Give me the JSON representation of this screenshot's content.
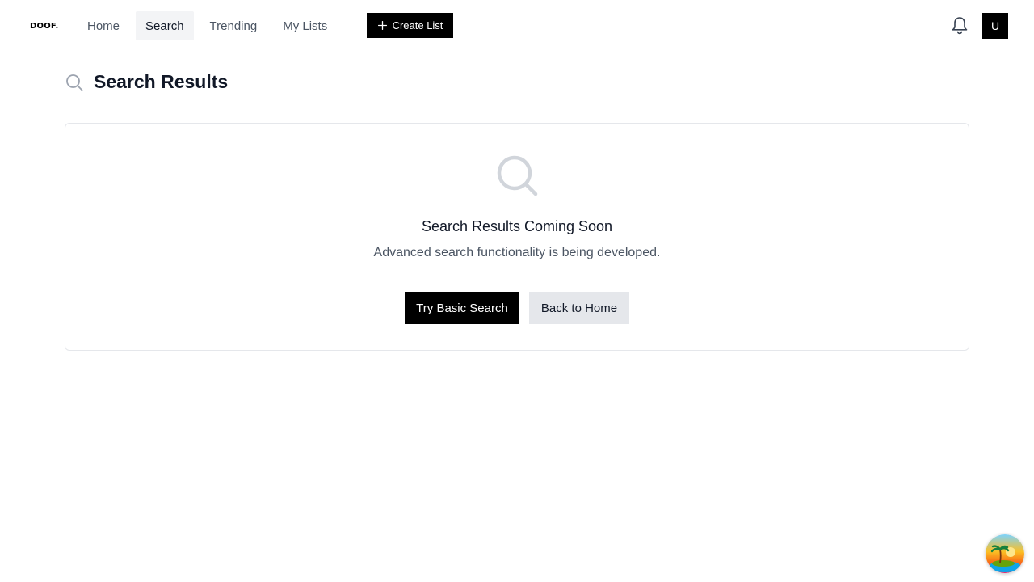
{
  "brand": {
    "logo_text": "DOOF."
  },
  "nav": {
    "items": [
      {
        "label": "Home",
        "active": false
      },
      {
        "label": "Search",
        "active": true
      },
      {
        "label": "Trending",
        "active": false
      },
      {
        "label": "My Lists",
        "active": false
      }
    ],
    "create_label": "Create List"
  },
  "user": {
    "avatar_initial": "U",
    "notifications_icon": "bell-icon"
  },
  "page": {
    "title": "Search Results",
    "title_icon": "search-icon"
  },
  "empty_state": {
    "icon": "search-icon",
    "title": "Search Results Coming Soon",
    "subtitle": "Advanced search functionality is being developed.",
    "primary_action": "Try Basic Search",
    "secondary_action": "Back to Home"
  },
  "colors": {
    "primary": "#000000",
    "secondary_button": "#e5e7eb",
    "active_nav_bg": "#f3f4f6",
    "muted_icon": "#d1d5db"
  }
}
